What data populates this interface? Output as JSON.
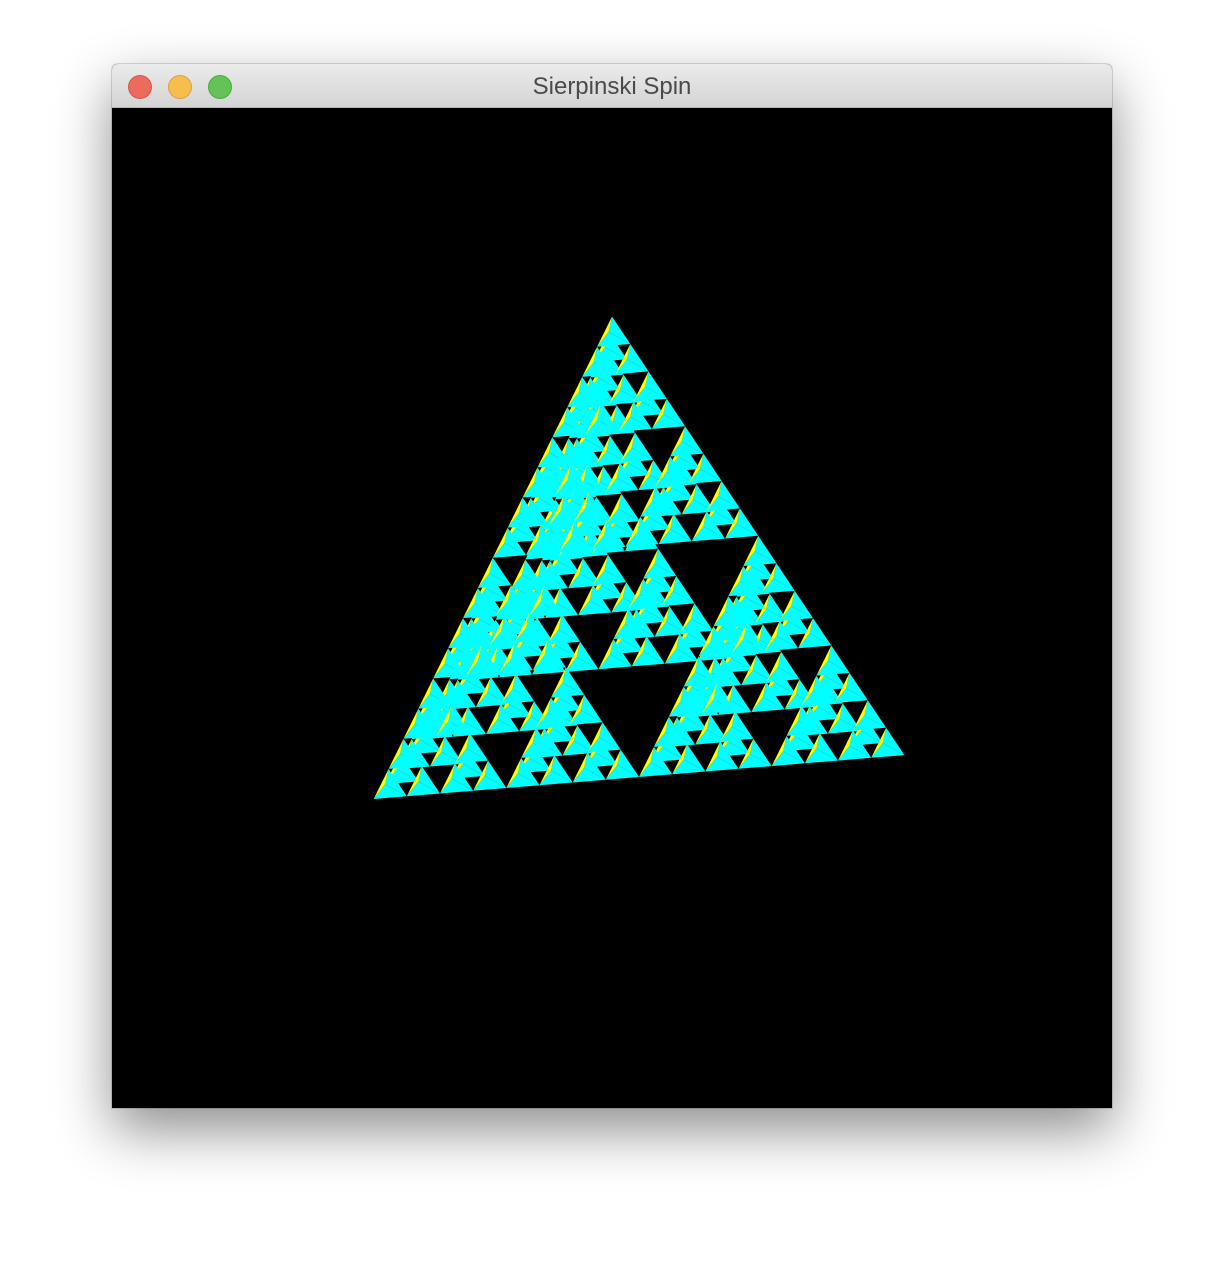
{
  "window": {
    "title": "Sierpinski Spin"
  },
  "controls": {
    "close": "close-icon",
    "minimize": "minimize-icon",
    "zoom": "zoom-icon"
  },
  "scene": {
    "background": "#000000",
    "colors": {
      "yellow": "#ffff00",
      "cyan": "#00ffff"
    },
    "fractal": "sierpinski-tetrahedron",
    "depth": 4,
    "rotation_degrees": {
      "x": 28,
      "y": 40,
      "z": 0
    }
  }
}
